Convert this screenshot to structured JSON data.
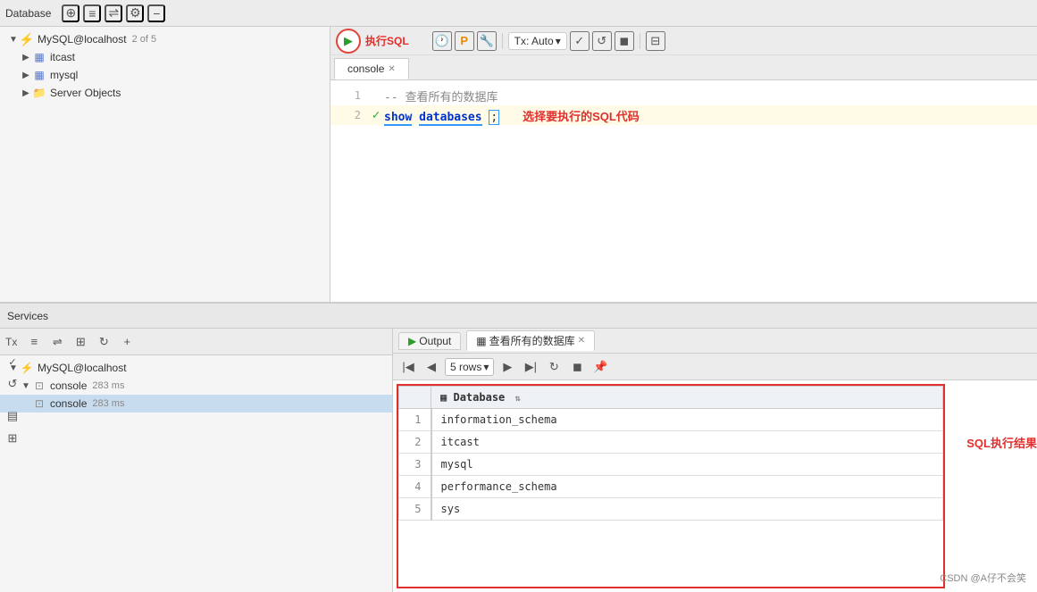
{
  "top_panel": {
    "database_label": "Database",
    "toolbar_icons": [
      "globe-add-icon",
      "align-icon",
      "split-icon",
      "gear-icon",
      "minus-icon"
    ],
    "editor_tab": "console",
    "connection": "MySQL@localhost",
    "connection_badge": "2 of 5",
    "run_tooltip": "执行SQL",
    "tx_label": "Tx: Auto",
    "code_lines": [
      {
        "num": "1",
        "indicator": "",
        "content": "-- 查看所有的数据库",
        "type": "comment"
      },
      {
        "num": "2",
        "indicator": "✓",
        "content": "show databases;",
        "type": "code"
      }
    ],
    "annotation_run": "执行SQL",
    "annotation_select": "选择要执行的SQL代码"
  },
  "bottom_panel": {
    "services_label": "Services",
    "tx_label": "Tx",
    "toolbar_icons": [
      "align-icon",
      "split-icon",
      "group-icon",
      "run-icon",
      "add-icon"
    ],
    "tree": {
      "connection": "MySQL@localhost",
      "node1_label": "console",
      "node1_time": "283 ms",
      "node2_label": "console",
      "node2_time": "283 ms"
    },
    "output_tabs": [
      {
        "label": "Output",
        "icon": "▶",
        "active": false
      },
      {
        "label": "查看所有的数据库",
        "active": true,
        "closable": true
      }
    ],
    "rows_label": "5 rows",
    "nav_icons": [
      "first-icon",
      "prev-icon",
      "next-icon",
      "last-icon",
      "refresh-icon",
      "stop-icon",
      "pin-icon"
    ],
    "result_columns": [
      "Database"
    ],
    "result_rows": [
      {
        "num": "1",
        "database": "information_schema"
      },
      {
        "num": "2",
        "database": "itcast"
      },
      {
        "num": "3",
        "database": "mysql"
      },
      {
        "num": "4",
        "database": "performance_schema"
      },
      {
        "num": "5",
        "database": "sys"
      }
    ],
    "annotation_result": "SQL执行结果",
    "bottom_credit": "CSDN @A仔不会笑"
  },
  "sidebar": {
    "items": [
      {
        "label": "MySQL@localhost",
        "badge": "2 of 5",
        "level": 0,
        "type": "connection"
      },
      {
        "label": "itcast",
        "level": 1,
        "type": "database"
      },
      {
        "label": "mysql",
        "level": 1,
        "type": "database"
      },
      {
        "label": "Server Objects",
        "level": 1,
        "type": "folder"
      }
    ]
  }
}
